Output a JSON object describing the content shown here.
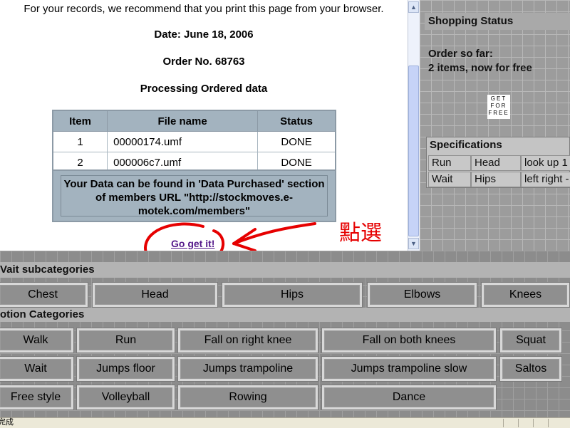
{
  "order": {
    "records_note": "For your records, we recommend that you print this page from your browser.",
    "date": "Date: June 18, 2006",
    "order_number": "Order No. 68763",
    "processing_title": "Processing Ordered data",
    "table": {
      "headers": [
        "Item",
        "File name",
        "Status"
      ],
      "rows": [
        [
          "1",
          "00000174.umf",
          "DONE"
        ],
        [
          "2",
          "000006c7.umf",
          "DONE"
        ]
      ]
    },
    "data_location": "Your Data can be found in 'Data Purchased' section of members URL \"http://stockmoves.e-motek.com/members\"",
    "go_get_it": "Go get it!",
    "annotation": "點選"
  },
  "shopping_status": {
    "title": "Shopping Status",
    "line1": "Order so far:",
    "line2": "2 items, now for free",
    "get_for_free": [
      "GET",
      "FOR",
      "FREE"
    ]
  },
  "specifications": {
    "title": "Specifications",
    "rows": [
      [
        "Run",
        "Head",
        "look up 1"
      ],
      [
        "Wait",
        "Hips",
        "left right -"
      ]
    ]
  },
  "wait_subcategories": {
    "title": "Vait subcategories",
    "buttons": [
      "Chest",
      "Head",
      "Hips",
      "Elbows",
      "Knees"
    ]
  },
  "motion_categories": {
    "title": "otion Categories",
    "rows": [
      [
        "Walk",
        "Run",
        "Fall on right knee",
        "Fall on both knees",
        "Squat"
      ],
      [
        "Wait",
        "Jumps floor",
        "Jumps trampoline",
        "Jumps trampoline slow",
        "Saltos"
      ],
      [
        "Free style",
        "Volleyball",
        "Rowing",
        "Dance"
      ]
    ]
  },
  "status_bar": {
    "text": "完成"
  },
  "colors": {
    "link": "#551a8b",
    "annotation": "#e60000"
  }
}
